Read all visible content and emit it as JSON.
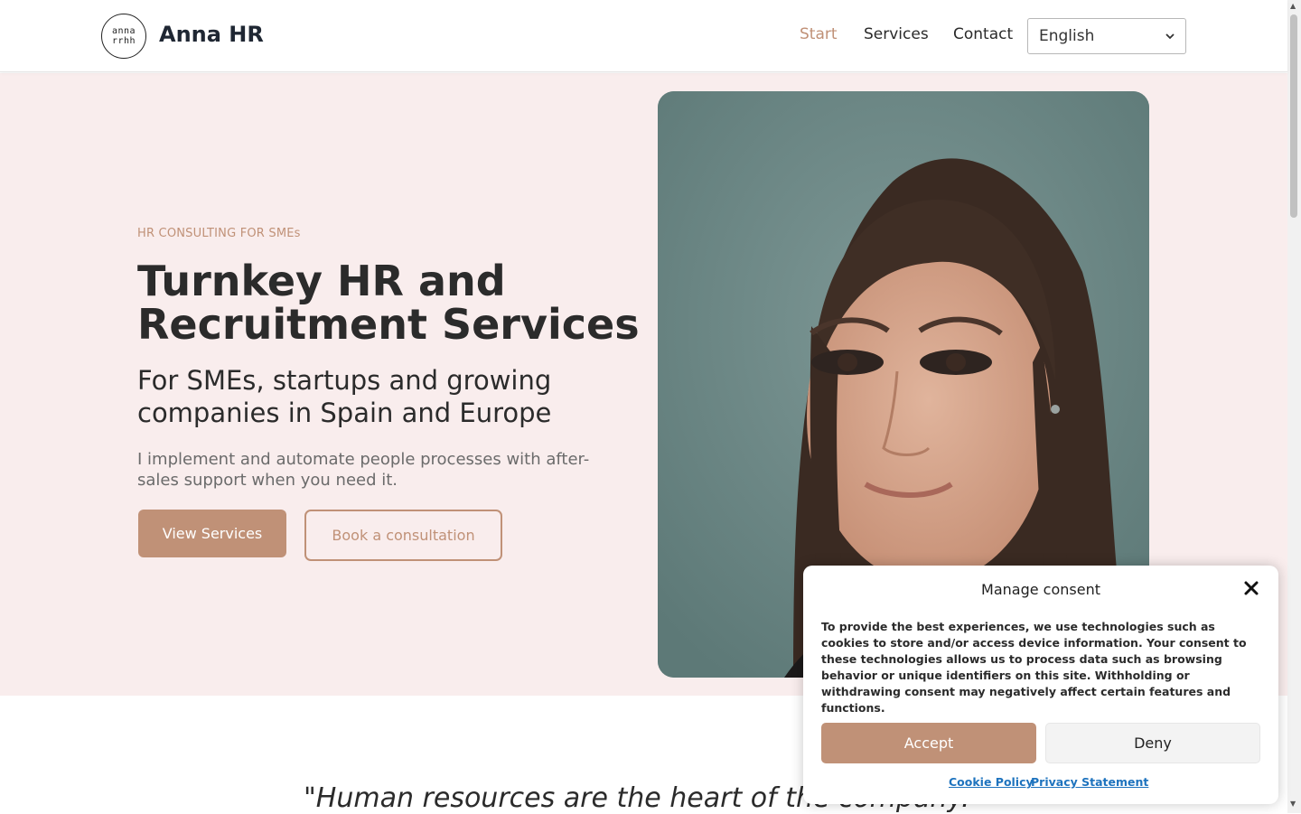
{
  "header": {
    "logo_top": "anna",
    "logo_bottom": "rrhh",
    "brand": "Anna HR",
    "nav": [
      {
        "label": "Start",
        "active": true
      },
      {
        "label": "Services",
        "active": false
      },
      {
        "label": "Contact",
        "active": false
      }
    ],
    "language": "English"
  },
  "hero": {
    "eyebrow": "HR CONSULTING FOR SMEs",
    "title": "Turnkey HR and Recruitment Services",
    "subtitle": "For SMEs, startups and growing companies in Spain and Europe",
    "lead": "I implement and automate people processes with after-sales support when you need it.",
    "primary_button": "View Services",
    "secondary_button": "Book a consultation"
  },
  "quote": "\"Human resources are the heart of the company.\"",
  "consent": {
    "title": "Manage consent",
    "body": "To provide the best experiences, we use technologies such as cookies to store and/or access device information. Your consent to these technologies allows us to process data such as browsing behavior or unique identifiers on this site. Withholding or withdrawing consent may negatively affect certain features and functions.",
    "accept": "Accept",
    "deny": "Deny",
    "cookie_policy": "Cookie Policy",
    "privacy_statement": "Privacy Statement"
  },
  "colors": {
    "accent": "#c09177",
    "hero_bg": "#f9eded",
    "link": "#1e73be"
  },
  "icons": {
    "close": "close-icon",
    "select": "chevron-down-icon"
  }
}
